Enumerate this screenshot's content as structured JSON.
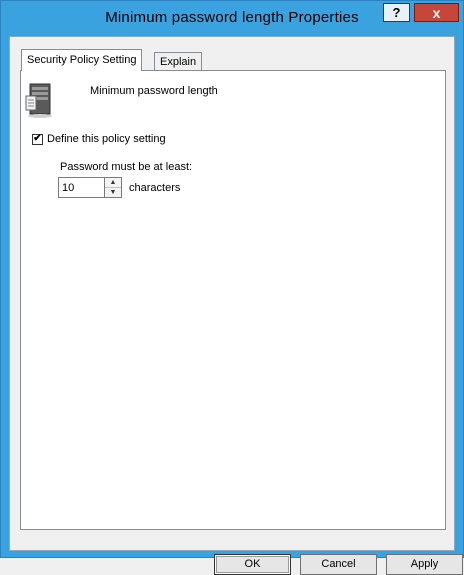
{
  "window": {
    "title": "Minimum password length Properties"
  },
  "titlebar": {
    "help_label": "?",
    "close_label": "x"
  },
  "tabs": [
    {
      "label": "Security Policy Setting"
    },
    {
      "label": "Explain"
    }
  ],
  "policy": {
    "name": "Minimum password length",
    "icon": "server-policy-icon"
  },
  "define": {
    "label": "Define this policy setting",
    "checked": true
  },
  "password": {
    "prompt": "Password must be at least:",
    "value": "10",
    "units": "characters"
  },
  "buttons": {
    "ok": "OK",
    "cancel": "Cancel",
    "apply": "Apply"
  }
}
